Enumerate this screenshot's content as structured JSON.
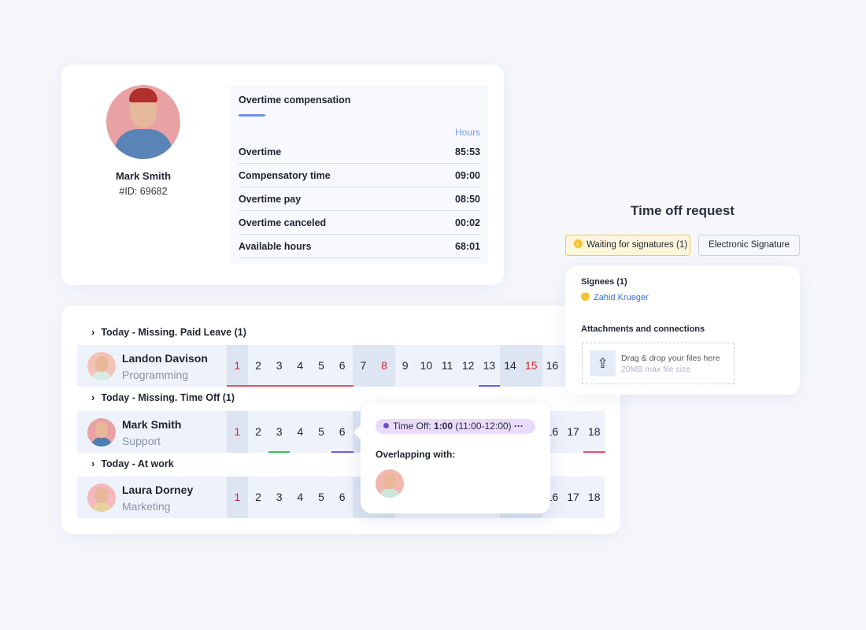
{
  "profile": {
    "name": "Mark Smith",
    "id": "#ID: 69682"
  },
  "overtime": {
    "title": "Overtime compensation",
    "unit_label": "Hours",
    "rows": [
      {
        "label": "Overtime",
        "value": "85:53"
      },
      {
        "label": "Compensatory time",
        "value": "09:00"
      },
      {
        "label": "Overtime pay",
        "value": "08:50"
      },
      {
        "label": "Overtime canceled",
        "value": "00:02"
      },
      {
        "label": "Available hours",
        "value": "68:01"
      }
    ]
  },
  "schedule": {
    "groups": [
      {
        "label": "Today - Missing. Paid Leave (1)"
      },
      {
        "label": "Today - Missing. Time Off (1)"
      },
      {
        "label": "Today - At work"
      }
    ],
    "shaded_days": [
      1,
      7,
      8,
      14,
      15
    ],
    "rows": [
      {
        "name": "Landon Davison",
        "dept": "Programming",
        "days": [
          {
            "d": 1,
            "red": true,
            "u": "#ef4b6c"
          },
          {
            "d": 2,
            "u": "#ef4b6c"
          },
          {
            "d": 3,
            "u": "#ef4b6c"
          },
          {
            "d": 4,
            "u": "#ef4b6c"
          },
          {
            "d": 5,
            "u": "#ef4b6c"
          },
          {
            "d": 6,
            "u": "#ef4b6c"
          },
          {
            "d": 7
          },
          {
            "d": 8,
            "red": true
          },
          {
            "d": 9
          },
          {
            "d": 10
          },
          {
            "d": 11
          },
          {
            "d": 12
          },
          {
            "d": 13,
            "u": "#6b5cf0"
          },
          {
            "d": 14
          },
          {
            "d": 15,
            "red": true
          },
          {
            "d": 16
          }
        ]
      },
      {
        "name": "Mark Smith",
        "dept": "Support",
        "days": [
          {
            "d": 1,
            "red": true
          },
          {
            "d": 2
          },
          {
            "d": 3,
            "u": "#3cc05a"
          },
          {
            "d": 4
          },
          {
            "d": 5
          },
          {
            "d": 6,
            "u": "#6b5cf0"
          },
          {
            "d": 16
          },
          {
            "d": 17
          },
          {
            "d": 18,
            "u": "#ef4b6c"
          }
        ]
      },
      {
        "name": "Laura Dorney",
        "dept": "Marketing",
        "days": [
          {
            "d": 1,
            "red": true
          },
          {
            "d": 2
          },
          {
            "d": 3
          },
          {
            "d": 4
          },
          {
            "d": 5
          },
          {
            "d": 6
          },
          {
            "d": 16
          },
          {
            "d": 17
          },
          {
            "d": 18
          }
        ]
      }
    ]
  },
  "popup": {
    "chip_prefix": "Time Off: ",
    "chip_bold": "1:00",
    "chip_range": " (11:00-12:00)",
    "more": "···",
    "overlap_label": "Overlapping with:"
  },
  "time_off": {
    "title": "Time off request",
    "waiting_label": "Waiting for signatures (1)",
    "esign_label": "Electronic Signature",
    "signees_label": "Signees (1)",
    "signee": "Zahid Krueger",
    "attachments_label": "Attachments and connections",
    "drop_text": "Drag & drop your files here",
    "drop_hint": "20MB max file size"
  }
}
